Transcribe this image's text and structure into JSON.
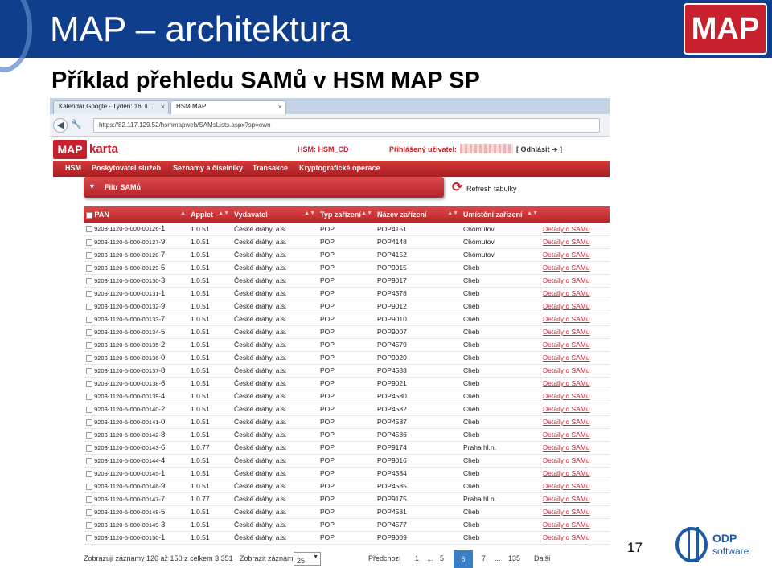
{
  "slide": {
    "title": "MAP – architektura",
    "logo_text": "MAP",
    "subtitle": "Příklad přehledu SAMů v HSM MAP SP",
    "page_number": "17",
    "footer_logo_line1": "ODP",
    "footer_logo_line2": "software"
  },
  "browser": {
    "tabs": [
      {
        "label": "Kalendář Google - Týden: 16. li..."
      },
      {
        "label": "HSM MAP"
      }
    ],
    "url": "https://82.117.129.52/hsmmapweb/SAMsLists.aspx?sp=own"
  },
  "app": {
    "logo": "MAP",
    "name": "karta",
    "hsm_label": "HSM: HSM_CD",
    "user_label": "Přihlášený uživatel:",
    "logout_label": "[ Odhlásit ➔ ]",
    "menu": [
      "HSM",
      "Poskytovatel služeb",
      "Seznamy a číselníky",
      "Transakce",
      "Kryptografické operace"
    ],
    "filter_label": "Filtr SAMů",
    "refresh_label": "Refresh tabulky"
  },
  "table": {
    "headers": [
      "PAN",
      "Applet",
      "Vydavatel",
      "Typ zařízení",
      "Název zařízení",
      "Umístění zařízení",
      ""
    ],
    "rows": [
      {
        "pan": "9203-1120-5-000-00126-",
        "chk": "1",
        "applet": "1.0.51",
        "vydavatel": "České dráhy, a.s.",
        "typ": "POP",
        "nazev": "POP4151",
        "umisteni": "Chomutov",
        "detail": "Detaily o SAMu"
      },
      {
        "pan": "9203-1120-5-000-00127-",
        "chk": "9",
        "applet": "1.0.51",
        "vydavatel": "České dráhy, a.s.",
        "typ": "POP",
        "nazev": "POP4148",
        "umisteni": "Chomutov",
        "detail": "Detaily o SAMu"
      },
      {
        "pan": "9203-1120-5-000-00128-",
        "chk": "7",
        "applet": "1.0.51",
        "vydavatel": "České dráhy, a.s.",
        "typ": "POP",
        "nazev": "POP4152",
        "umisteni": "Chomutov",
        "detail": "Detaily o SAMu"
      },
      {
        "pan": "9203-1120-5-000-00129-",
        "chk": "5",
        "applet": "1.0.51",
        "vydavatel": "České dráhy, a.s.",
        "typ": "POP",
        "nazev": "POP9015",
        "umisteni": "Cheb",
        "detail": "Detaily o SAMu"
      },
      {
        "pan": "9203-1120-5-000-00130-",
        "chk": "3",
        "applet": "1.0.51",
        "vydavatel": "České dráhy, a.s.",
        "typ": "POP",
        "nazev": "POP9017",
        "umisteni": "Cheb",
        "detail": "Detaily o SAMu"
      },
      {
        "pan": "9203-1120-5-000-00131-",
        "chk": "1",
        "applet": "1.0.51",
        "vydavatel": "České dráhy, a.s.",
        "typ": "POP",
        "nazev": "POP4578",
        "umisteni": "Cheb",
        "detail": "Detaily o SAMu"
      },
      {
        "pan": "9203-1120-5-000-00132-",
        "chk": "9",
        "applet": "1.0.51",
        "vydavatel": "České dráhy, a.s.",
        "typ": "POP",
        "nazev": "POP9012",
        "umisteni": "Cheb",
        "detail": "Detaily o SAMu"
      },
      {
        "pan": "9203-1120-5-000-00133-",
        "chk": "7",
        "applet": "1.0.51",
        "vydavatel": "České dráhy, a.s.",
        "typ": "POP",
        "nazev": "POP9010",
        "umisteni": "Cheb",
        "detail": "Detaily o SAMu"
      },
      {
        "pan": "9203-1120-5-000-00134-",
        "chk": "5",
        "applet": "1.0.51",
        "vydavatel": "České dráhy, a.s.",
        "typ": "POP",
        "nazev": "POP9007",
        "umisteni": "Cheb",
        "detail": "Detaily o SAMu"
      },
      {
        "pan": "9203-1120-5-000-00135-",
        "chk": "2",
        "applet": "1.0.51",
        "vydavatel": "České dráhy, a.s.",
        "typ": "POP",
        "nazev": "POP4579",
        "umisteni": "Cheb",
        "detail": "Detaily o SAMu"
      },
      {
        "pan": "9203-1120-5-000-00136-",
        "chk": "0",
        "applet": "1.0.51",
        "vydavatel": "České dráhy, a.s.",
        "typ": "POP",
        "nazev": "POP9020",
        "umisteni": "Cheb",
        "detail": "Detaily o SAMu"
      },
      {
        "pan": "9203-1120-5-000-00137-",
        "chk": "8",
        "applet": "1.0.51",
        "vydavatel": "České dráhy, a.s.",
        "typ": "POP",
        "nazev": "POP4583",
        "umisteni": "Cheb",
        "detail": "Detaily o SAMu"
      },
      {
        "pan": "9203-1120-5-000-00138-",
        "chk": "6",
        "applet": "1.0.51",
        "vydavatel": "České dráhy, a.s.",
        "typ": "POP",
        "nazev": "POP9021",
        "umisteni": "Cheb",
        "detail": "Detaily o SAMu"
      },
      {
        "pan": "9203-1120-5-000-00139-",
        "chk": "4",
        "applet": "1.0.51",
        "vydavatel": "České dráhy, a.s.",
        "typ": "POP",
        "nazev": "POP4580",
        "umisteni": "Cheb",
        "detail": "Detaily o SAMu"
      },
      {
        "pan": "9203-1120-5-000-00140-",
        "chk": "2",
        "applet": "1.0.51",
        "vydavatel": "České dráhy, a.s.",
        "typ": "POP",
        "nazev": "POP4582",
        "umisteni": "Cheb",
        "detail": "Detaily o SAMu"
      },
      {
        "pan": "9203-1120-5-000-00141-",
        "chk": "0",
        "applet": "1.0.51",
        "vydavatel": "České dráhy, a.s.",
        "typ": "POP",
        "nazev": "POP4587",
        "umisteni": "Cheb",
        "detail": "Detaily o SAMu"
      },
      {
        "pan": "9203-1120-5-000-00142-",
        "chk": "8",
        "applet": "1.0.51",
        "vydavatel": "České dráhy, a.s.",
        "typ": "POP",
        "nazev": "POP4586",
        "umisteni": "Cheb",
        "detail": "Detaily o SAMu"
      },
      {
        "pan": "9203-1120-5-000-00143-",
        "chk": "6",
        "applet": "1.0.77",
        "vydavatel": "České dráhy, a.s.",
        "typ": "POP",
        "nazev": "POP9174",
        "umisteni": "Praha hl.n.",
        "detail": "Detaily o SAMu"
      },
      {
        "pan": "9203-1120-5-000-00144-",
        "chk": "4",
        "applet": "1.0.51",
        "vydavatel": "České dráhy, a.s.",
        "typ": "POP",
        "nazev": "POP9016",
        "umisteni": "Cheb",
        "detail": "Detaily o SAMu"
      },
      {
        "pan": "9203-1120-5-000-00145-",
        "chk": "1",
        "applet": "1.0.51",
        "vydavatel": "České dráhy, a.s.",
        "typ": "POP",
        "nazev": "POP4584",
        "umisteni": "Cheb",
        "detail": "Detaily o SAMu"
      },
      {
        "pan": "9203-1120-5-000-00146-",
        "chk": "9",
        "applet": "1.0.51",
        "vydavatel": "České dráhy, a.s.",
        "typ": "POP",
        "nazev": "POP4585",
        "umisteni": "Cheb",
        "detail": "Detaily o SAMu"
      },
      {
        "pan": "9203-1120-5-000-00147-",
        "chk": "7",
        "applet": "1.0.77",
        "vydavatel": "České dráhy, a.s.",
        "typ": "POP",
        "nazev": "POP9175",
        "umisteni": "Praha hl.n.",
        "detail": "Detaily o SAMu"
      },
      {
        "pan": "9203-1120-5-000-00148-",
        "chk": "5",
        "applet": "1.0.51",
        "vydavatel": "České dráhy, a.s.",
        "typ": "POP",
        "nazev": "POP4581",
        "umisteni": "Cheb",
        "detail": "Detaily o SAMu"
      },
      {
        "pan": "9203-1120-5-000-00149-",
        "chk": "3",
        "applet": "1.0.51",
        "vydavatel": "České dráhy, a.s.",
        "typ": "POP",
        "nazev": "POP4577",
        "umisteni": "Cheb",
        "detail": "Detaily o SAMu"
      },
      {
        "pan": "9203-1120-5-000-00150-",
        "chk": "1",
        "applet": "1.0.51",
        "vydavatel": "České dráhy, a.s.",
        "typ": "POP",
        "nazev": "POP9009",
        "umisteni": "Cheb",
        "detail": "Detaily o SAMu"
      }
    ]
  },
  "pager": {
    "summary": "Zobrazuji záznamy 126 až 150 z celkem 3 351",
    "page_size_label": "Zobrazit záznamů",
    "page_size": "25",
    "prev": "Předchozí",
    "pages": [
      "1",
      "...",
      "5",
      "6",
      "7",
      "...",
      "135"
    ],
    "current_page": "6",
    "next": "Další"
  },
  "colors": {
    "slide_header": "#0f3f8c",
    "brand_red": "#c8202c",
    "pager_active": "#3b7ec8"
  }
}
